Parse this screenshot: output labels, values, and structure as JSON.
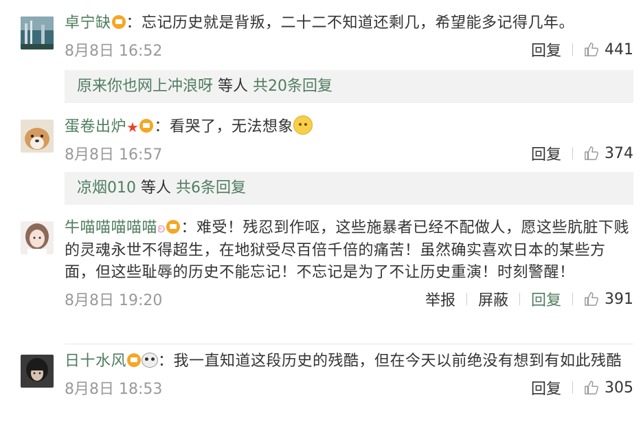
{
  "comments": [
    {
      "username": "卓宁缺",
      "text": "忘记历史就是背叛，二十二不知道还剩几，希望能多记得几年。",
      "time": "8月8日 16:52",
      "reply_label": "回复",
      "likes": "441"
    },
    {
      "username": "蛋卷出炉",
      "text": "看哭了，无法想象",
      "time": "8月8日 16:57",
      "reply_label": "回复",
      "likes": "374"
    },
    {
      "username": "牛喵喵喵喵喵",
      "text": "难受！残忍到作呕，这些施暴者已经不配做人，愿这些肮脏下贱的灵魂永世不得超生，在地狱受尽百倍千倍的痛苦！虽然确实喜欢日本的某些方面，但这些耻辱的历史不能忘记！不忘记是为了不让历史重演！时刻警醒！",
      "time": "8月8日 19:20",
      "report_label": "举报",
      "block_label": "屏蔽",
      "reply_label": "回复",
      "likes": "391"
    },
    {
      "username": "日十水风",
      "text": "我一直知道这段历史的残酷，但在今天以前绝没有想到有如此残酷",
      "time": "8月8日 18:53",
      "reply_label": "回复",
      "likes": "305"
    }
  ],
  "reply_threads": [
    {
      "user": "原来你也网上冲浪呀",
      "middle": "等人",
      "count": "共20条回复"
    },
    {
      "user": "凉烟010",
      "middle": "等人",
      "count": "共6条回复"
    }
  ],
  "colors": {
    "username": "#4f7d5e",
    "meta": "#999999",
    "reply_bg": "#f2f2f2"
  }
}
